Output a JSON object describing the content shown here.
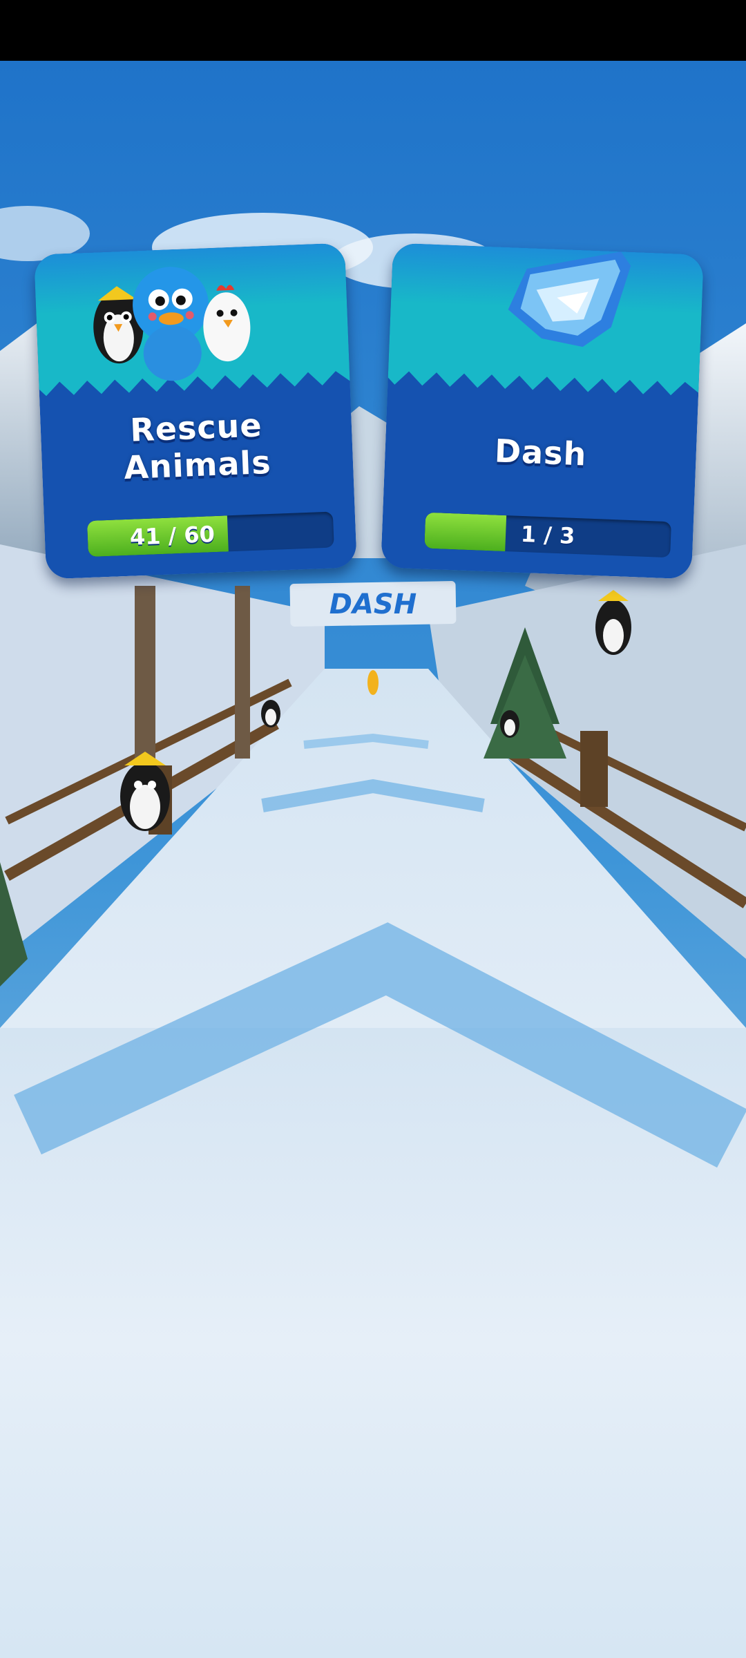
{
  "banner": {
    "text": "DASH"
  },
  "missions": [
    {
      "title": "Rescue\nAnimals",
      "progress_text": "41 / 60",
      "current": 41,
      "target": 60,
      "icon": "animals-group-icon"
    },
    {
      "title": "Dash",
      "progress_text": "1 / 3",
      "current": 1,
      "target": 3,
      "icon": "dash-crystal-icon"
    }
  ],
  "colors": {
    "card_blue": "#1552b0",
    "card_teal": "#17b7c9",
    "progress_green": "#6bc92c",
    "sky": "#2a86d6",
    "snow": "#e4eef7"
  }
}
